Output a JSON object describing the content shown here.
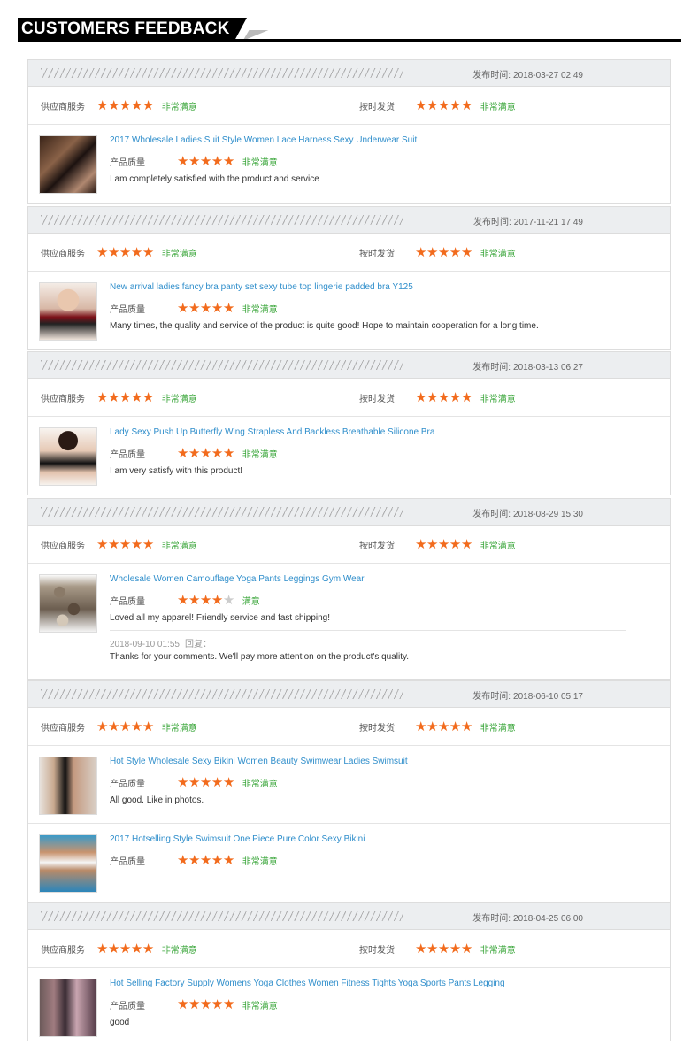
{
  "header": {
    "title": "CUSTOMERS FEEDBACK"
  },
  "labels": {
    "date": "发布时间:",
    "supplier_service": "供应商服务",
    "on_time": "按时发货",
    "quality": "产品质量",
    "very_satisfied": "非常满意",
    "satisfied": "满意",
    "reply": "回复："
  },
  "colors": {
    "star": "#f26b1d",
    "satisfied_text": "#3aa63a",
    "title_link": "#2f8ecb"
  },
  "feedbacks": [
    {
      "date": "2018-03-27 02:49",
      "supplier_stars": 5,
      "supplier_text": "非常满意",
      "ontime_stars": 5,
      "ontime_text": "非常满意",
      "products": [
        {
          "title": "2017 Wholesale Ladies Suit Style Women Lace Harness Sexy Underwear Suit",
          "stars": 5,
          "rating_text": "非常满意",
          "comment": "I am completely satisfied with the product and service",
          "thumb": "lingerie-black"
        }
      ]
    },
    {
      "date": "2017-11-21 17:49",
      "supplier_stars": 5,
      "supplier_text": "非常满意",
      "ontime_stars": 5,
      "ontime_text": "非常满意",
      "products": [
        {
          "title": "New arrival ladies fancy bra panty set sexy tube top lingerie padded bra Y125",
          "stars": 5,
          "rating_text": "非常满意",
          "comment": "Many times, the quality and service of the product is quite good! Hope to maintain cooperation for a long time.",
          "thumb": "lingerie-red"
        }
      ]
    },
    {
      "date": "2018-03-13 06:27",
      "supplier_stars": 5,
      "supplier_text": "非常满意",
      "ontime_stars": 5,
      "ontime_text": "非常满意",
      "products": [
        {
          "title": "Lady Sexy Push Up Butterfly Wing Strapless And Backless Breathable Silicone Bra",
          "stars": 5,
          "rating_text": "非常满意",
          "comment": "I am very satisfy with this product!",
          "thumb": "silicone-bra"
        }
      ]
    },
    {
      "date": "2018-08-29 15:30",
      "supplier_stars": 5,
      "supplier_text": "非常满意",
      "ontime_stars": 5,
      "ontime_text": "非常满意",
      "products": [
        {
          "title": "Wholesale Women Camouflage Yoga Pants Leggings Gym Wear",
          "stars": 4,
          "rating_text": "满意",
          "comment": "Loved all my apparel! Friendly service and fast shipping!",
          "thumb": "camo-pants",
          "reply_date": "2018-09-10 01:55",
          "reply_text": "Thanks for your comments. We'll pay more attention on the product's quality."
        }
      ]
    },
    {
      "date": "2018-06-10 05:17",
      "supplier_stars": 5,
      "supplier_text": "非常满意",
      "ontime_stars": 5,
      "ontime_text": "非常满意",
      "products": [
        {
          "title": "Hot Style Wholesale Sexy Bikini Women Beauty Swimwear Ladies Swimsuit",
          "stars": 5,
          "rating_text": "非常满意",
          "comment": "All good. Like in photos.",
          "thumb": "swimsuit-black"
        },
        {
          "title": "2017 Hotselling Style Swimsuit One Piece Pure Color Sexy Bikini",
          "stars": 5,
          "rating_text": "非常满意",
          "comment": "",
          "thumb": "bikini-white"
        }
      ]
    },
    {
      "date": "2018-04-25 06:00",
      "supplier_stars": 5,
      "supplier_text": "非常满意",
      "ontime_stars": 5,
      "ontime_text": "非常满意",
      "products": [
        {
          "title": "Hot Selling Factory Supply Womens Yoga Clothes Women Fitness Tights Yoga Sports Pants Legging",
          "stars": 5,
          "rating_text": "非常满意",
          "comment": "good",
          "thumb": "yoga-leggings"
        }
      ]
    }
  ]
}
